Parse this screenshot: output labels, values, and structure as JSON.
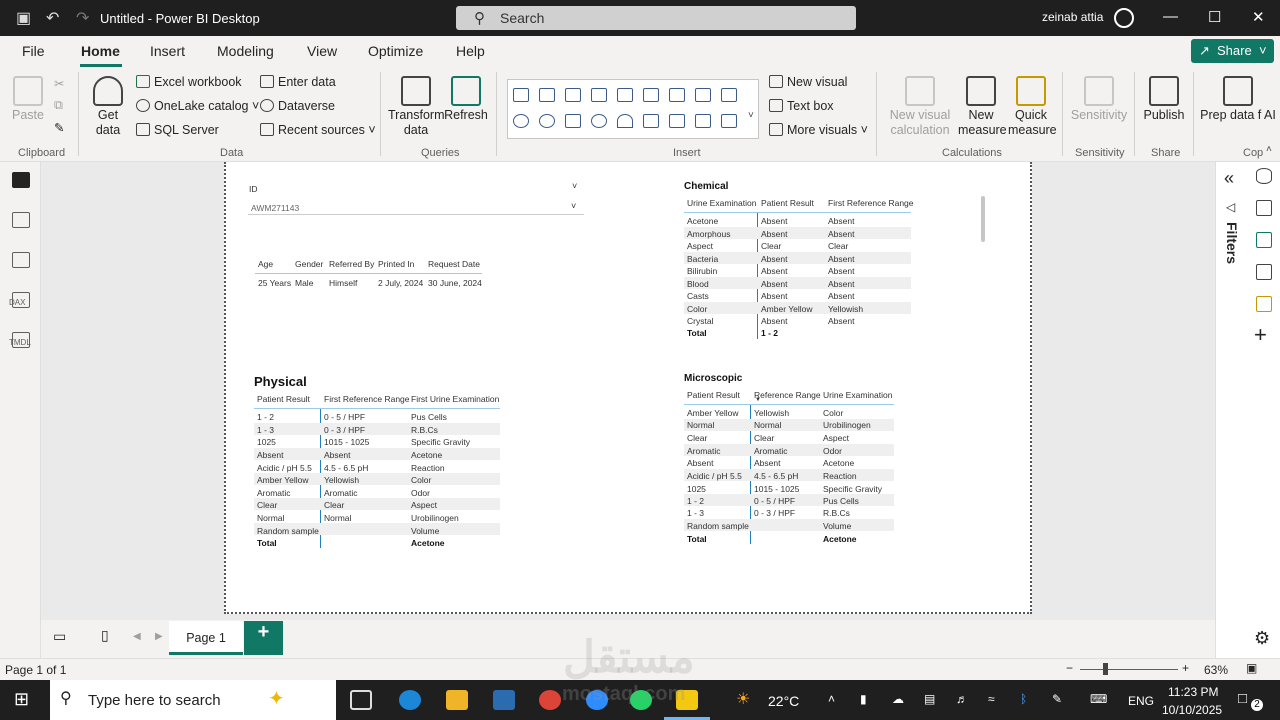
{
  "app": {
    "title": "Untitled - Power BI Desktop",
    "user": "zeinab attia"
  },
  "search": {
    "label": "Search"
  },
  "menu": {
    "items": [
      "File",
      "Home",
      "Insert",
      "Modeling",
      "View",
      "Optimize",
      "Help"
    ],
    "share": "Share"
  },
  "ribbon": {
    "paste": "Paste",
    "get_data": "Get data",
    "excel": "Excel workbook",
    "onelake": "OneLake catalog",
    "sql": "SQL Server",
    "enter_data": "Enter data",
    "dataverse": "Dataverse",
    "recent": "Recent sources",
    "transform": "Transform data",
    "refresh": "Refresh",
    "new_visual": "New visual",
    "text_box": "Text box",
    "more_visuals": "More visuals",
    "new_visual_calc": "New visual calculation",
    "new_measure": "New measure",
    "quick_measure": "Quick measure",
    "sensitivity": "Sensitivity",
    "publish": "Publish",
    "prep_ai": "Prep data f AI",
    "groups": {
      "clipboard": "Clipboard",
      "data": "Data",
      "queries": "Queries",
      "insert": "Insert",
      "calculations": "Calculations",
      "sensitivity": "Sensitivity",
      "share": "Share",
      "cop": "Cop"
    }
  },
  "left_rail": {
    "dax": "DAX",
    "tmdl": "TMDL"
  },
  "right_pane": {
    "filters": "Filters"
  },
  "report": {
    "slicer": {
      "label": "ID",
      "value": "AWM271143"
    },
    "patient": {
      "headers": [
        "Age",
        "Gender",
        "Referred By",
        "Printed In",
        "Request Date"
      ],
      "row": [
        "25 Years",
        "Male",
        "Himself",
        "2 July, 2024",
        "30 June, 2024"
      ]
    },
    "chemical": {
      "title": "Chemical",
      "headers": [
        "Urine Examination",
        "Patient Result",
        "First Reference Range"
      ],
      "rows": [
        [
          "Acetone",
          "Absent",
          "Absent"
        ],
        [
          "Amorphous",
          "Absent",
          "Absent"
        ],
        [
          "Aspect",
          "Clear",
          "Clear"
        ],
        [
          "Bacteria",
          "Absent",
          "Absent"
        ],
        [
          "Bilirubin",
          "Absent",
          "Absent"
        ],
        [
          "Blood",
          "Absent",
          "Absent"
        ],
        [
          "Casts",
          "Absent",
          "Absent"
        ],
        [
          "Color",
          "Amber Yellow",
          "Yellowish"
        ],
        [
          "Crystal",
          "Absent",
          "Absent"
        ]
      ],
      "total": [
        "Total",
        "1 - 2",
        ""
      ]
    },
    "physical": {
      "title": "Physical",
      "headers": [
        "Patient Result",
        "First Reference Range",
        "First Urine Examination"
      ],
      "rows": [
        [
          "1 - 2",
          "0 - 5 / HPF",
          "Pus Cells"
        ],
        [
          "1 - 3",
          "0 - 3 / HPF",
          "R.B.Cs"
        ],
        [
          "1025",
          "1015 - 1025",
          "Specific Gravity"
        ],
        [
          "Absent",
          "Absent",
          "Acetone"
        ],
        [
          "Acidic / pH 5.5",
          "4.5 - 6.5 pH",
          "Reaction"
        ],
        [
          "Amber Yellow",
          "Yellowish",
          "Color"
        ],
        [
          "Aromatic",
          "Aromatic",
          "Odor"
        ],
        [
          "Clear",
          "Clear",
          "Aspect"
        ],
        [
          "Normal",
          "Normal",
          "Urobilinogen"
        ],
        [
          "Random sample",
          "",
          "Volume"
        ]
      ],
      "total": [
        "Total",
        "",
        "Acetone"
      ]
    },
    "microscopic": {
      "title": "Microscopic",
      "headers": [
        "Patient Result",
        "Reference Range",
        "Urine Examination"
      ],
      "rows": [
        [
          "Amber Yellow",
          "Yellowish",
          "Color"
        ],
        [
          "Normal",
          "Normal",
          "Urobilinogen"
        ],
        [
          "Clear",
          "Clear",
          "Aspect"
        ],
        [
          "Aromatic",
          "Aromatic",
          "Odor"
        ],
        [
          "Absent",
          "Absent",
          "Acetone"
        ],
        [
          "Acidic / pH 5.5",
          "4.5 - 6.5 pH",
          "Reaction"
        ],
        [
          "1025",
          "1015 - 1025",
          "Specific Gravity"
        ],
        [
          "1 - 2",
          "0 - 5 / HPF",
          "Pus Cells"
        ],
        [
          "1 - 3",
          "0 - 3 / HPF",
          "R.B.Cs"
        ],
        [
          "Random sample",
          "",
          "Volume"
        ]
      ],
      "total": [
        "Total",
        "",
        "Acetone"
      ]
    }
  },
  "pages": {
    "tab": "Page 1",
    "add": "+"
  },
  "status": {
    "page": "Page 1 of 1",
    "zoom": "63%"
  },
  "taskbar": {
    "search": "Type here to search",
    "weather": "22°C",
    "lang": "ENG",
    "time": "11:23 PM",
    "date": "10/10/2025",
    "notif": "2"
  },
  "watermark": {
    "text": "مستقل",
    "sub": "mostaql.com"
  },
  "colors": {
    "accent": "#117865",
    "titlebar": "#1f1f1f"
  }
}
